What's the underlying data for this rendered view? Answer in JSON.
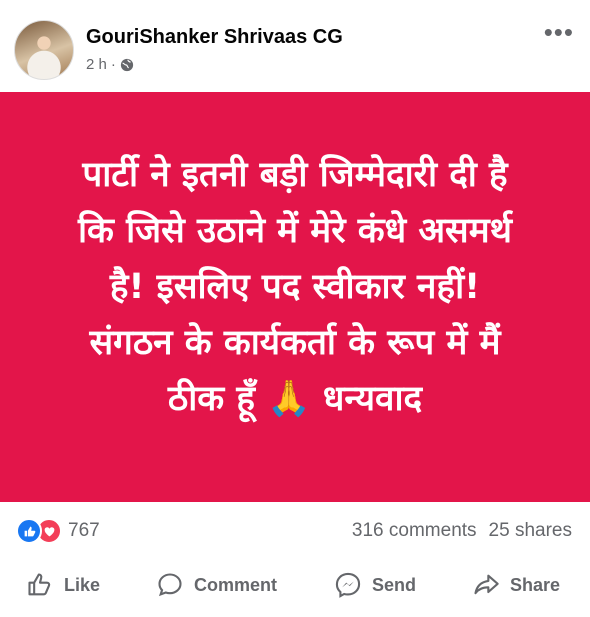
{
  "post": {
    "author": "GouriShanker Shrivaas CG",
    "time": "2 h",
    "separator": "·",
    "text": "पार्टी ने इतनी बड़ी जिम्मेदारी दी है\nकि जिसे उठाने में मेरे कंधे असमर्थ\nहै! इसलिए पद स्वीकार नहीं!\nसंगठन के कार्यकर्ता के रूप में मैं\nठीक हूँ 🙏 धन्यवाद",
    "card_color": "#e3154a"
  },
  "stats": {
    "reaction_count": "767",
    "comments": "316 comments",
    "shares": "25 shares"
  },
  "actions": {
    "like": "Like",
    "comment": "Comment",
    "send": "Send",
    "share": "Share"
  }
}
